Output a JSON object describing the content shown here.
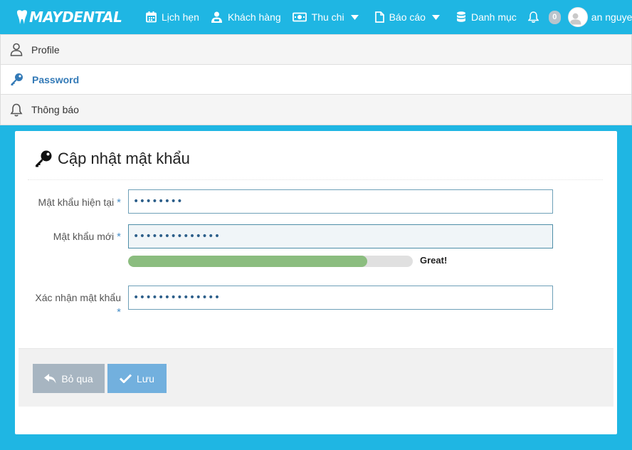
{
  "brand": {
    "logo_text": "MAYDENTAL"
  },
  "nav": {
    "items": [
      {
        "label": "Lịch hẹn",
        "icon": "calendar-icon"
      },
      {
        "label": "Khách hàng",
        "icon": "patient-icon"
      },
      {
        "label": "Thu chi",
        "icon": "money-icon",
        "dropdown": true
      },
      {
        "label": "Báo cáo",
        "icon": "file-icon",
        "dropdown": true
      },
      {
        "label": "Danh mục",
        "icon": "database-icon"
      }
    ],
    "notification_count": "0",
    "user_name": "an nguye"
  },
  "menu": {
    "items": [
      {
        "label": "Profile",
        "icon": "user-icon",
        "active": false
      },
      {
        "label": "Password",
        "icon": "key-icon",
        "active": true
      },
      {
        "label": "Thông báo",
        "icon": "bell-icon",
        "active": false
      }
    ]
  },
  "form": {
    "title": "Cập nhật mật khẩu",
    "fields": {
      "current": {
        "label": "Mật khẩu hiện tại",
        "value": "••••••••"
      },
      "new": {
        "label": "Mật khẩu mới",
        "value": "••••••••••••••"
      },
      "confirm": {
        "label": "Xác nhận mật khẩu",
        "value": "••••••••••••••"
      }
    },
    "required_mark": "*",
    "strength": {
      "level": 0.84,
      "label": "Great!"
    },
    "buttons": {
      "cancel": "Bỏ qua",
      "save": "Lưu"
    }
  },
  "colors": {
    "header": "#1fb6e3",
    "active_menu": "#337ab7",
    "strength_fill": "#8bbd7f",
    "cancel_button": "#a7b5c1",
    "save_button": "#72b0de"
  }
}
